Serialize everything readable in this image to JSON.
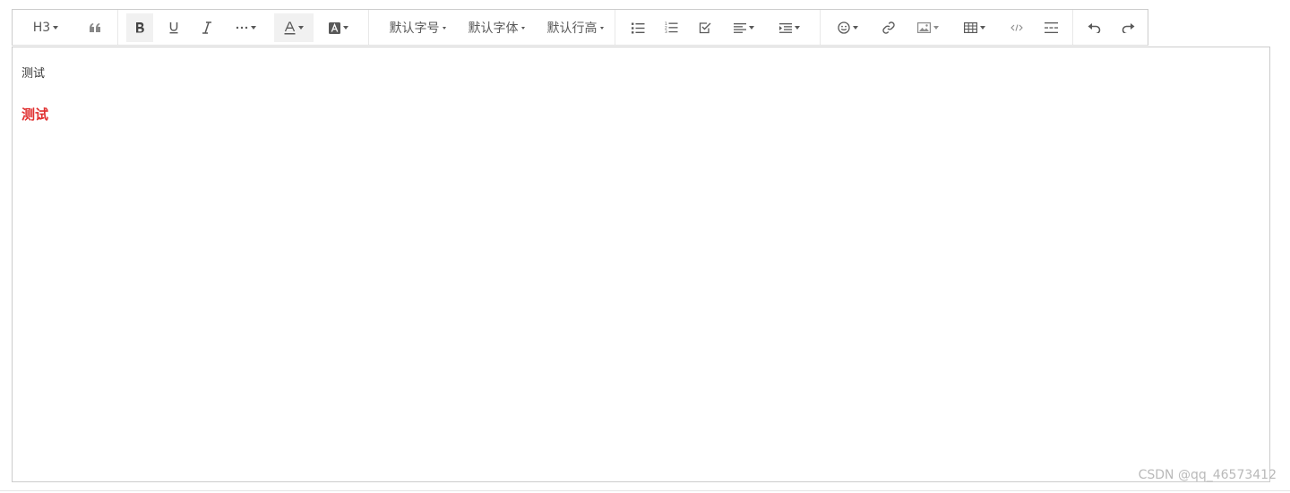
{
  "toolbar": {
    "heading_label": "H3",
    "font_size_label": "默认字号",
    "font_family_label": "默认字体",
    "line_height_label": "默认行高"
  },
  "editor": {
    "paragraph_text": "测试",
    "heading_text": "测试",
    "heading_color": "#e02f2f"
  },
  "watermark": "CSDN @qq_46573412",
  "colors": {
    "icon": "#595959",
    "active_bg": "#f1f1f1",
    "border": "#cccccc"
  }
}
